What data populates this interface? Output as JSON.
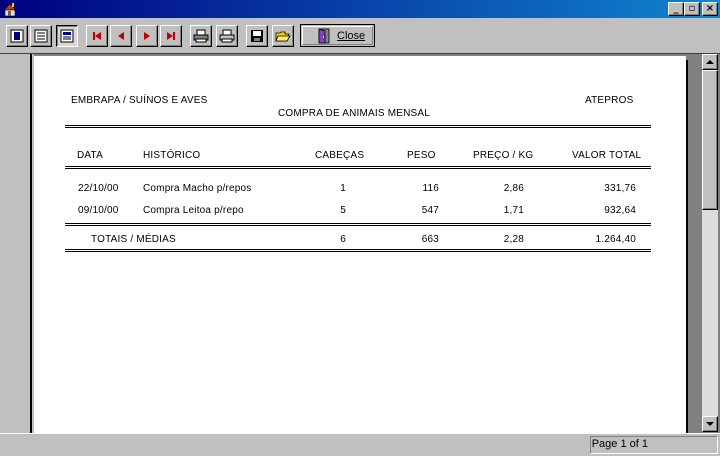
{
  "window": {
    "minimize_label": "_",
    "maximize_label": "▫",
    "close_label": "×"
  },
  "toolbar": {
    "close_label": "Close"
  },
  "report": {
    "company": "EMBRAPA / SUÍNOS E AVES",
    "title": "COMPRA DE ANIMAIS MENSAL",
    "system": "ATEPROS",
    "columns": [
      "DATA",
      "HISTÓRICO",
      "CABEÇAS",
      "PESO",
      "PREÇO / KG",
      "VALOR TOTAL"
    ],
    "rows": [
      {
        "data": "22/10/00",
        "historico": "Compra Macho p/repos",
        "cabecas": "1",
        "peso": "116",
        "preco_kg": "2,86",
        "valor_total": "331,76"
      },
      {
        "data": "09/10/00",
        "historico": "Compra Leitoa p/repo",
        "cabecas": "5",
        "peso": "547",
        "preco_kg": "1,71",
        "valor_total": "932,64"
      }
    ],
    "totals": {
      "label": "TOTAIS / MÉDIAS",
      "cabecas": "6",
      "peso": "663",
      "preco_kg": "2,28",
      "valor_total": "1.264,40"
    }
  },
  "status": {
    "page_text": "Page 1 of 1"
  }
}
